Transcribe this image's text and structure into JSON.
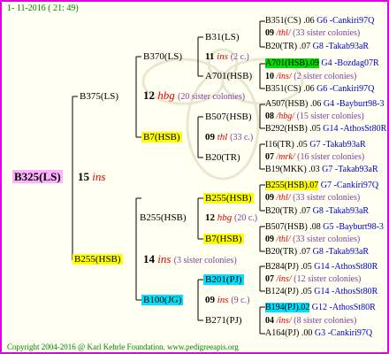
{
  "header": {
    "date": "1- 11-2016 ( 21: 49)"
  },
  "root": {
    "name": "B325(LS)",
    "gen": "15",
    "code": "ins"
  },
  "sire_side": {
    "name": "B375(LS)",
    "gen": "12",
    "code": "hbg",
    "sisters": "(20 sister colonies)",
    "sire": {
      "name": "B370(LS)",
      "gen": "11",
      "code": "ins",
      "sisters": "(2 c.)",
      "sire": {
        "name": "B31(LS)"
      },
      "dam": {
        "name": "A701(HSB)"
      }
    },
    "dam": {
      "name": "B7(HSB)",
      "gen": "09",
      "code": "thl",
      "sisters": "(33 c.)",
      "sire": {
        "name": "B507(HSB)"
      },
      "dam": {
        "name": "B20(TR)"
      }
    }
  },
  "dam_side": {
    "name": "B255(HSB)",
    "gen": "14",
    "code": "ins",
    "sisters": "(3 sister colonies)",
    "sire": {
      "name": "B255(HSB)",
      "gen": "12",
      "code": "hbg",
      "sisters": "(20 c.)",
      "sire": {
        "name": "B255(HSB)"
      },
      "dam": {
        "name": "B7(HSB)"
      }
    },
    "dam": {
      "name": "B100(JG)",
      "gen": "09",
      "code": "ins",
      "sisters": "(9 c.)",
      "sire": {
        "name": "B201(PJ)"
      },
      "dam": {
        "name": "B271(PJ)"
      }
    }
  },
  "gen5": {
    "r1": {
      "id": "B351(CS)",
      "year": ".06",
      "loc": "G6 -Cankiri97Q"
    },
    "r2": {
      "gen": "09",
      "code": "/thl/",
      "sis": "(33 sister colonies)"
    },
    "r3": {
      "id": "B20(TR)",
      "year": ".07",
      "loc": "G8 -Takab93aR"
    },
    "r4": {
      "id": "A701(HSB)",
      "year": ".09",
      "loc": "G4 -Bozdag07R"
    },
    "r5": {
      "gen": "10",
      "code": "/ins/",
      "sis": "(2 sister colonies)"
    },
    "r6": {
      "id": "B351(CS)",
      "year": ".06",
      "loc": "G6 -Cankiri97Q"
    },
    "r7": {
      "id": "A507(HSB)",
      "year": ".06",
      "loc": "G4 -Bayburt98-3"
    },
    "r8": {
      "gen": "08",
      "code": "/hbg/",
      "sis": "(15 sister colonies)"
    },
    "r9": {
      "id": "B292(HSB)",
      "year": ".05",
      "loc": "G14 -AthosSt80R"
    },
    "r10": {
      "id": "I16(TR)",
      "year": ".05",
      "loc": "G7 -Takab93aR"
    },
    "r11": {
      "gen": "07",
      "code": "/mrk/",
      "sis": "(16 sister colonies)"
    },
    "r12": {
      "id": "B19(MKK)",
      "year": ".03",
      "loc": "G7 -Takab93aR"
    },
    "r13": {
      "id": "B255(HSB)",
      "year": ".07",
      "loc": "G7 -Cankiri97Q"
    },
    "r14": {
      "gen": "09",
      "code": "/thl/",
      "sis": "(33 sister colonies)"
    },
    "r15": {
      "id": "B20(TR)",
      "year": ".07",
      "loc": "G8 -Takab93aR"
    },
    "r16": {
      "id": "B507(HSB)",
      "year": ".08",
      "loc": "G5 -Bayburt98-3"
    },
    "r17": {
      "gen": "09",
      "code": "/thl/",
      "sis": "(33 sister colonies)"
    },
    "r18": {
      "id": "B20(TR)",
      "year": ".07",
      "loc": "G8 -Takab93aR"
    },
    "r19": {
      "id": "B284(PJ)",
      "year": ".05",
      "loc": "G14 -AthosSt80R"
    },
    "r20": {
      "gen": "07",
      "code": "/ins/",
      "sis": "(12 sister colonies)"
    },
    "r21": {
      "id": "B124(PJ)",
      "year": ".05",
      "loc": "G14 -AthosSt80R"
    },
    "r22": {
      "id": "B194(PJ)",
      "year": ".02",
      "loc": "G12 -AthosSt80R"
    },
    "r23": {
      "gen": "04",
      "code": "/ins/",
      "sis": "(8 sister colonies)"
    },
    "r24": {
      "id": "A164(PJ)",
      "year": ".00",
      "loc": "G3 -Cankiri97Q"
    }
  },
  "footer": {
    "copyright": "Copyright 2004-2016 @ Karl Kehrle Foundation.",
    "url": "www.pedigreeapis.org"
  },
  "colors": {
    "frame": "#e000e0",
    "code": "#e00000",
    "location": "#0000cc",
    "highlight_yellow": "#ffff00",
    "highlight_green": "#00dd00",
    "highlight_cyan": "#00e0ff",
    "highlight_pink": "#ffb0ff"
  }
}
